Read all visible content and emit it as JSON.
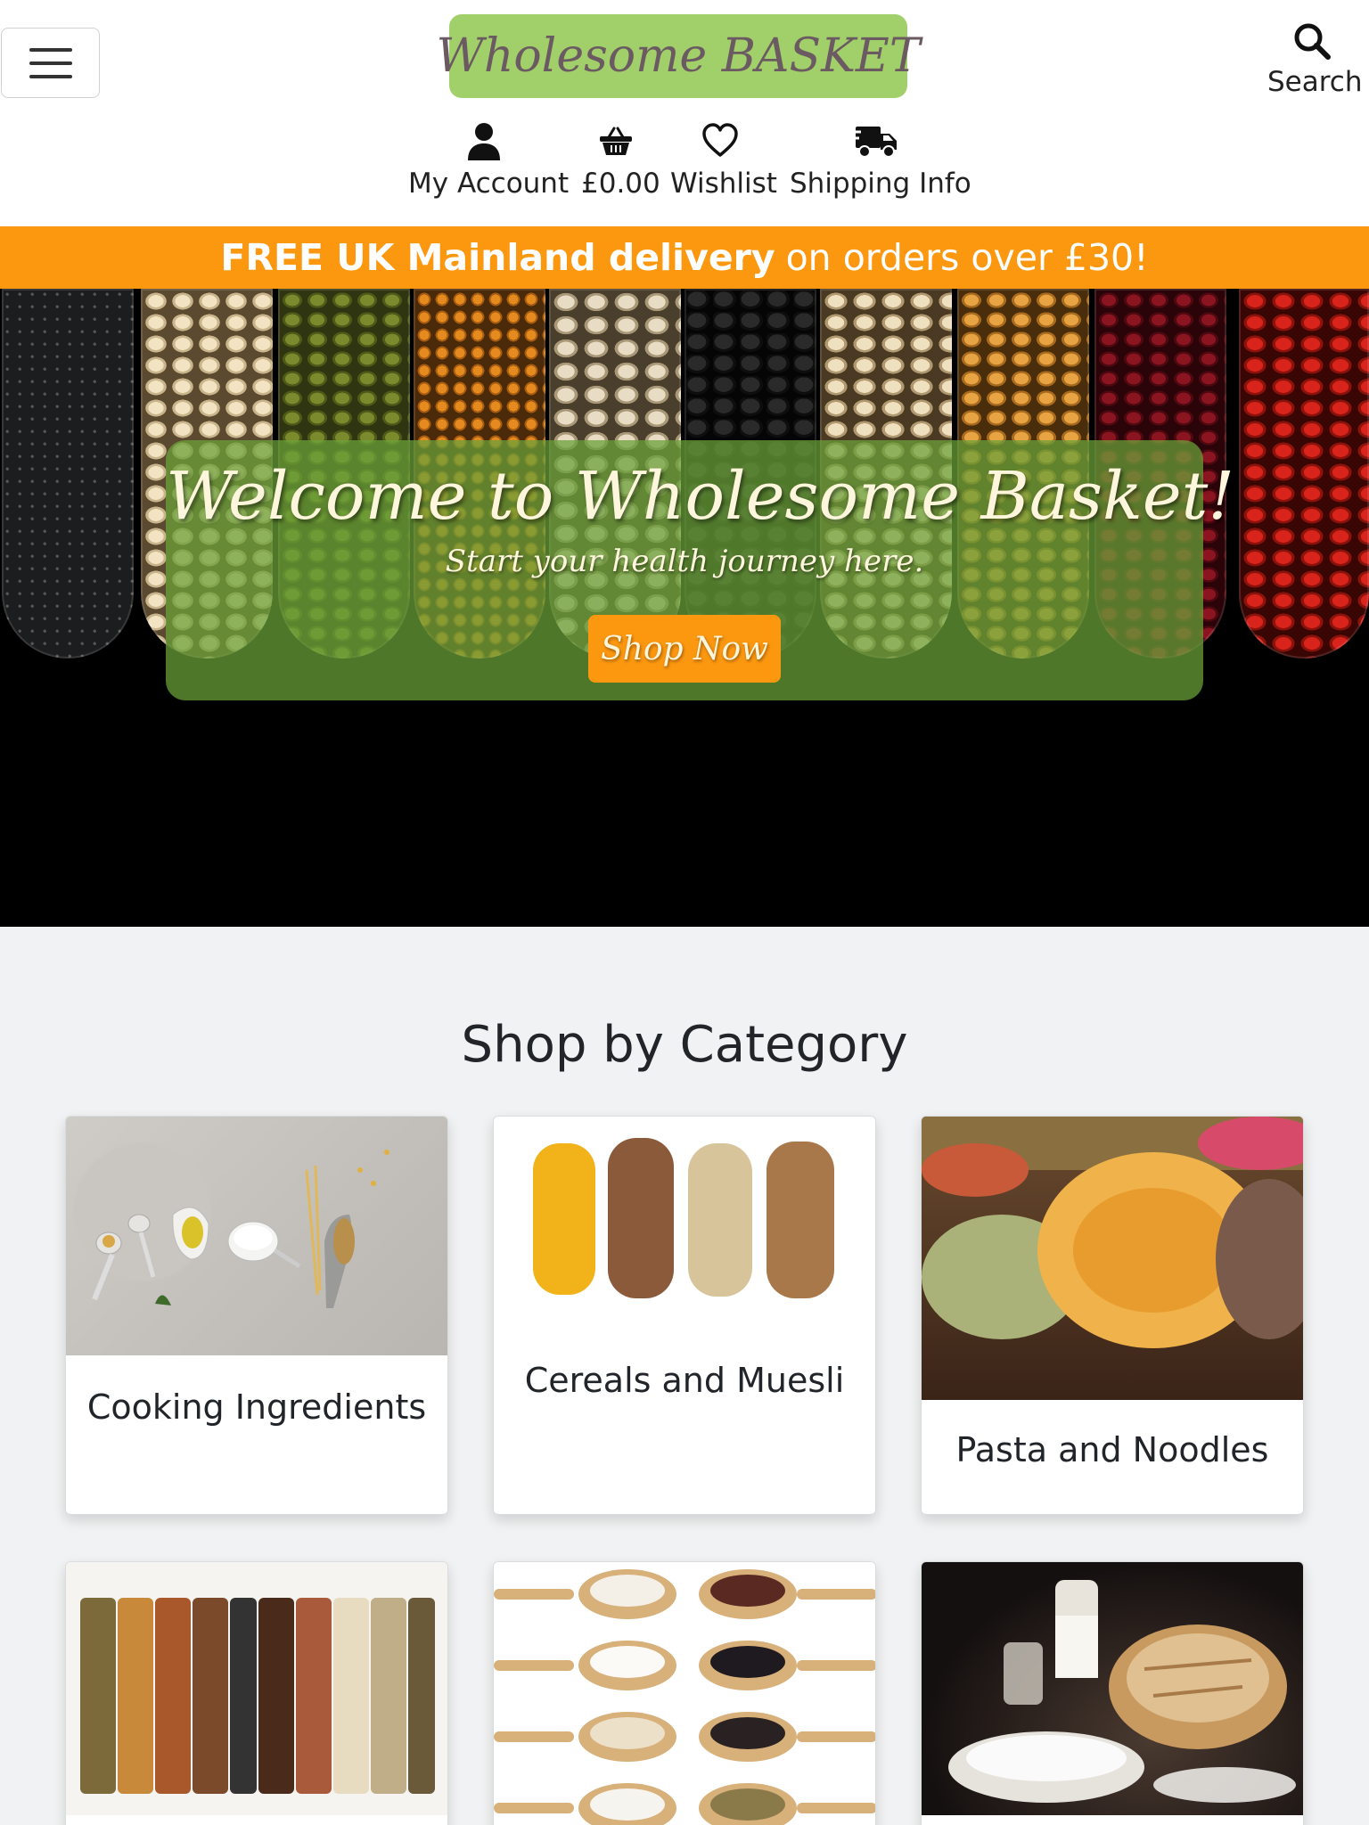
{
  "header": {
    "logo_text": "Wholesome BASKET",
    "menu_icon": "hamburger-menu-icon",
    "search_label": "Search",
    "nav": [
      {
        "label": "My Account",
        "icon": "user-icon"
      },
      {
        "label": "£0.00",
        "icon": "basket-icon"
      },
      {
        "label": "Wishlist",
        "icon": "heart-icon"
      },
      {
        "label": "Shipping Info",
        "icon": "truck-icon"
      }
    ]
  },
  "promo": {
    "bold_text": "FREE UK Mainland delivery",
    "rest_text": "on orders over £30!"
  },
  "hero": {
    "title": "Welcome to Wholesome Basket!",
    "subtitle": "Start your health journey here.",
    "cta_label": "Shop Now"
  },
  "categories": {
    "heading": "Shop by Category",
    "items": [
      {
        "label": "Cooking Ingredients"
      },
      {
        "label": "Cereals and Muesli"
      },
      {
        "label": "Pasta and Noodles"
      },
      {
        "label": ""
      },
      {
        "label": ""
      },
      {
        "label": ""
      }
    ]
  },
  "colors": {
    "accent_orange": "#fc9710",
    "logo_green": "#a1cf6a",
    "overlay_green": "#6aa038"
  }
}
